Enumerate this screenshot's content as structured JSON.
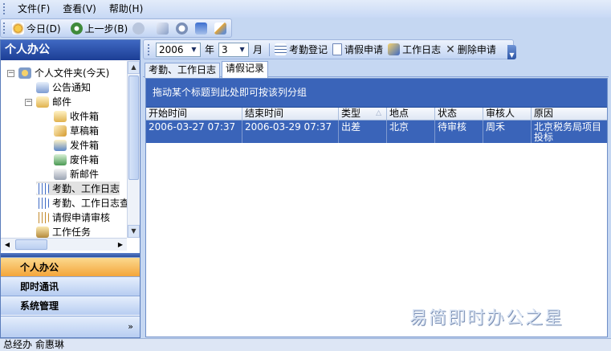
{
  "menu": [
    "文件(F)",
    "查看(V)",
    "帮助(H)"
  ],
  "toolbar": {
    "today": "今日(D)",
    "prev": "上一步(B)"
  },
  "left_panel": {
    "title": "个人办公",
    "tree": [
      {
        "label": "个人文件夹(今天)",
        "icon": "personal-folder-icon"
      },
      {
        "label": "公告通知",
        "icon": "notice-icon"
      },
      {
        "label": "邮件",
        "icon": "mail-folder-icon"
      },
      {
        "label": "收件箱",
        "icon": "inbox-icon"
      },
      {
        "label": "草稿箱",
        "icon": "drafts-icon"
      },
      {
        "label": "发件箱",
        "icon": "outbox-icon"
      },
      {
        "label": "废件箱",
        "icon": "trash-icon"
      },
      {
        "label": "新邮件",
        "icon": "new-mail-icon"
      },
      {
        "label": "考勤、工作日志",
        "icon": "calendar-icon"
      },
      {
        "label": "考勤、工作日志查",
        "icon": "calendar-search-icon"
      },
      {
        "label": "请假申请审核",
        "icon": "leave-review-icon"
      },
      {
        "label": "工作任务",
        "icon": "task-icon"
      }
    ],
    "nav": [
      "个人办公",
      "即时通讯",
      "系统管理"
    ],
    "footer": "»"
  },
  "filter_bar": {
    "year_value": "2006",
    "year_label": "年",
    "month_value": "3",
    "month_label": "月",
    "buttons": [
      "考勤登记",
      "请假申请",
      "工作日志",
      "删除申请"
    ]
  },
  "tabs": [
    "考勤、工作日志",
    "请假记录"
  ],
  "grid": {
    "group_hint": "拖动某个标题到此处即可按该列分组",
    "columns": [
      "开始时间",
      "结束时间",
      "类型",
      "地点",
      "状态",
      "审核人",
      "原因"
    ],
    "rows": [
      [
        "2006-03-27 07:37",
        "2006-03-29 07:37",
        "出差",
        "北京",
        "待审核",
        "周禾",
        "北京税务局项目投标"
      ]
    ]
  },
  "watermark": "易简即时办公之星",
  "status": "总经办 俞惠琳",
  "colors": {
    "accent": "#3a64b9",
    "active_nav": "#f4a53a",
    "header": "#1c3e95"
  }
}
